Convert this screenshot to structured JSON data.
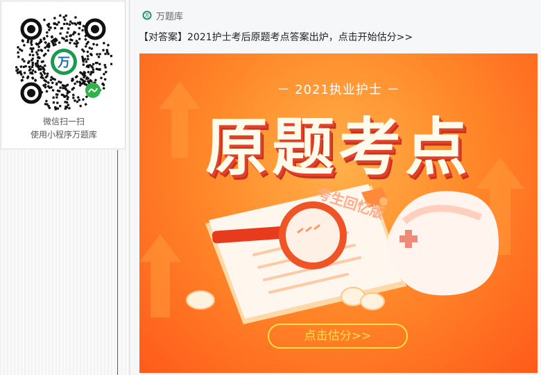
{
  "qr_card": {
    "caption_line1": "微信扫一扫",
    "caption_line2": "使用小程序万题库",
    "logo_text": "万",
    "badge_icon": "mini-program-icon"
  },
  "message": {
    "source_name": "万题库",
    "source_icon": "wantiku-logo-icon",
    "headline": "【对答案】2021护士考后原题考点答案出炉，点击开始估分>>"
  },
  "banner": {
    "subtitle": "－ 2021执业护士 －",
    "title": "原题考点",
    "stamp_text": "考生回忆版",
    "cta_label": "点击估分>>",
    "colors": {
      "accent": "#ff6a1f",
      "cta": "#ffe14a",
      "title": "#fffbea"
    }
  }
}
